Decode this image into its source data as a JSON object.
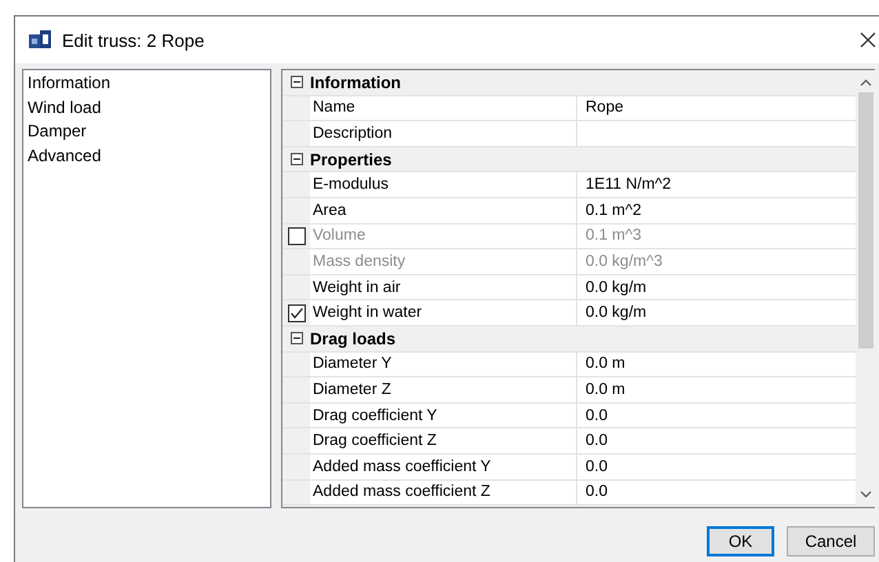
{
  "window": {
    "title": "Edit truss: 2 Rope"
  },
  "sidebar": {
    "items": [
      {
        "label": "Information",
        "selected": false
      },
      {
        "label": "Wind load",
        "selected": false
      },
      {
        "label": "Damper",
        "selected": false
      },
      {
        "label": "Advanced",
        "selected": false
      }
    ]
  },
  "property_grid": {
    "rows": [
      {
        "kind": "category",
        "label": "Information",
        "expanded": true
      },
      {
        "kind": "property",
        "name": "Name",
        "value": "Rope",
        "disabled": false
      },
      {
        "kind": "property",
        "name": "Description",
        "disabled": false
      },
      {
        "kind": "category",
        "label": "Properties",
        "expanded": true
      },
      {
        "kind": "property",
        "name": "E-modulus",
        "value": "1E11 N/m^2",
        "disabled": false
      },
      {
        "kind": "property",
        "name": "Area",
        "value": "0.1 m^2",
        "disabled": false
      },
      {
        "kind": "property",
        "name": "Volume",
        "value": "0.1 m^3",
        "disabled": true,
        "checked": false
      },
      {
        "kind": "property",
        "name": "Mass density",
        "value": "0.0 kg/m^3",
        "disabled": true
      },
      {
        "kind": "property",
        "name": "Weight in air",
        "value": "0.0 kg/m",
        "disabled": false
      },
      {
        "kind": "property",
        "name": "Weight in water",
        "value": "0.0 kg/m",
        "disabled": false,
        "checked": true
      },
      {
        "kind": "category",
        "label": "Drag loads",
        "expanded": true
      },
      {
        "kind": "property",
        "name": "Diameter Y",
        "value": "0.0 m",
        "disabled": false
      },
      {
        "kind": "property",
        "name": "Diameter Z",
        "value": "0.0 m",
        "disabled": false
      },
      {
        "kind": "property",
        "name": "Drag coefficient Y",
        "value": "0.0",
        "disabled": false
      },
      {
        "kind": "property",
        "name": "Drag coefficient Z",
        "value": "0.0",
        "disabled": false
      },
      {
        "kind": "property",
        "name": "Added mass coefficient Y",
        "value": "0.0",
        "disabled": false
      },
      {
        "kind": "property",
        "name": "Added mass coefficient Z",
        "value": "0.0",
        "disabled": false
      }
    ]
  },
  "buttons": [
    {
      "label": "OK",
      "default": true
    },
    {
      "label": "Cancel",
      "default": false
    }
  ]
}
